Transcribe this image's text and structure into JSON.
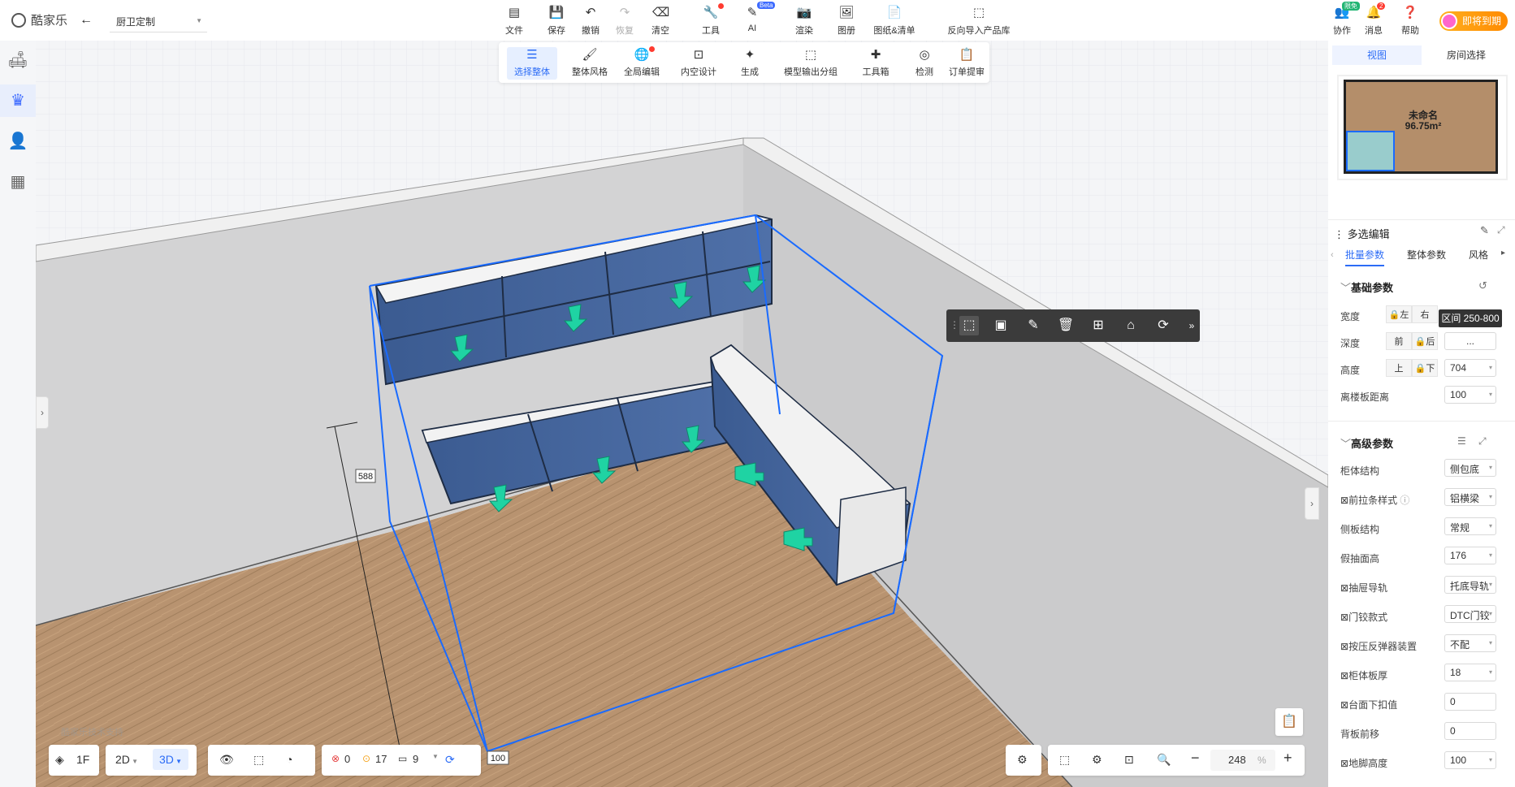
{
  "app": {
    "logo": "酷家乐",
    "project": "厨卫定制"
  },
  "toolbar": {
    "file": "文件",
    "save": "保存",
    "undo": "撤销",
    "redo": "恢复",
    "clear": "清空",
    "tools": "工具",
    "ai": "AI",
    "ai_badge": "Beta",
    "render": "渲染",
    "album": "图册",
    "drawings": "图纸&清单",
    "reverse_import": "反向导入产品库"
  },
  "header_right": {
    "collab": "协作",
    "collab_badge": "限免",
    "messages": "消息",
    "messages_count": "2",
    "help": "帮助",
    "expire": "即将到期"
  },
  "toolbar2": [
    "选择整体",
    "整体风格",
    "全局编辑",
    "内空设计",
    "生成",
    "模型输出分组",
    "工具箱",
    "检测",
    "订单提审"
  ],
  "view_tabs": {
    "view": "视图",
    "room": "房间选择"
  },
  "minimap": {
    "room_name": "未命名",
    "area": "96.75m²"
  },
  "panel": {
    "title": "多选编辑",
    "tabs": [
      "批量参数",
      "整体参数",
      "风格"
    ],
    "basic_section": "基础参数",
    "width_label": "宽度",
    "width_left": "左",
    "width_right": "右",
    "depth_label": "深度",
    "depth_front": "前",
    "depth_back": "后",
    "depth_value": "...",
    "height_label": "高度",
    "height_up": "上",
    "height_down": "下",
    "height_value": "704",
    "floor_label": "离楼板距离",
    "floor_value": "100",
    "advanced_section": "高级参数",
    "rows": [
      {
        "label": "柜体结构",
        "value": "侧包底",
        "mark": false
      },
      {
        "label": "前拉条样式",
        "value": "铝横梁",
        "mark": true
      },
      {
        "label": "侧板结构",
        "value": "常规",
        "mark": false
      },
      {
        "label": "假抽面高",
        "value": "176",
        "mark": false
      },
      {
        "label": "抽屉导轨",
        "value": "托底导轨",
        "mark": true
      },
      {
        "label": "门铰款式",
        "value": "DTC门铰",
        "mark": true
      },
      {
        "label": "按压反弹器装置",
        "value": "不配",
        "mark": true
      },
      {
        "label": "柜体板厚",
        "value": "18",
        "mark": true
      },
      {
        "label": "台面下扣值",
        "value": "0",
        "mark": true
      },
      {
        "label": "背板前移",
        "value": "0",
        "mark": false
      },
      {
        "label": "地脚高度",
        "value": "100",
        "mark": true
      }
    ]
  },
  "tooltip": "区间 250-800",
  "scene": {
    "dim_height": "588",
    "dim_bottom": "100",
    "watermark": "酷家乐技术支持"
  },
  "bottom": {
    "floor": "1F",
    "mode2d": "2D",
    "mode3d": "3D",
    "errors": "0",
    "warnings": "17",
    "infos": "9",
    "zoom": "248",
    "zoom_unit": "%"
  }
}
